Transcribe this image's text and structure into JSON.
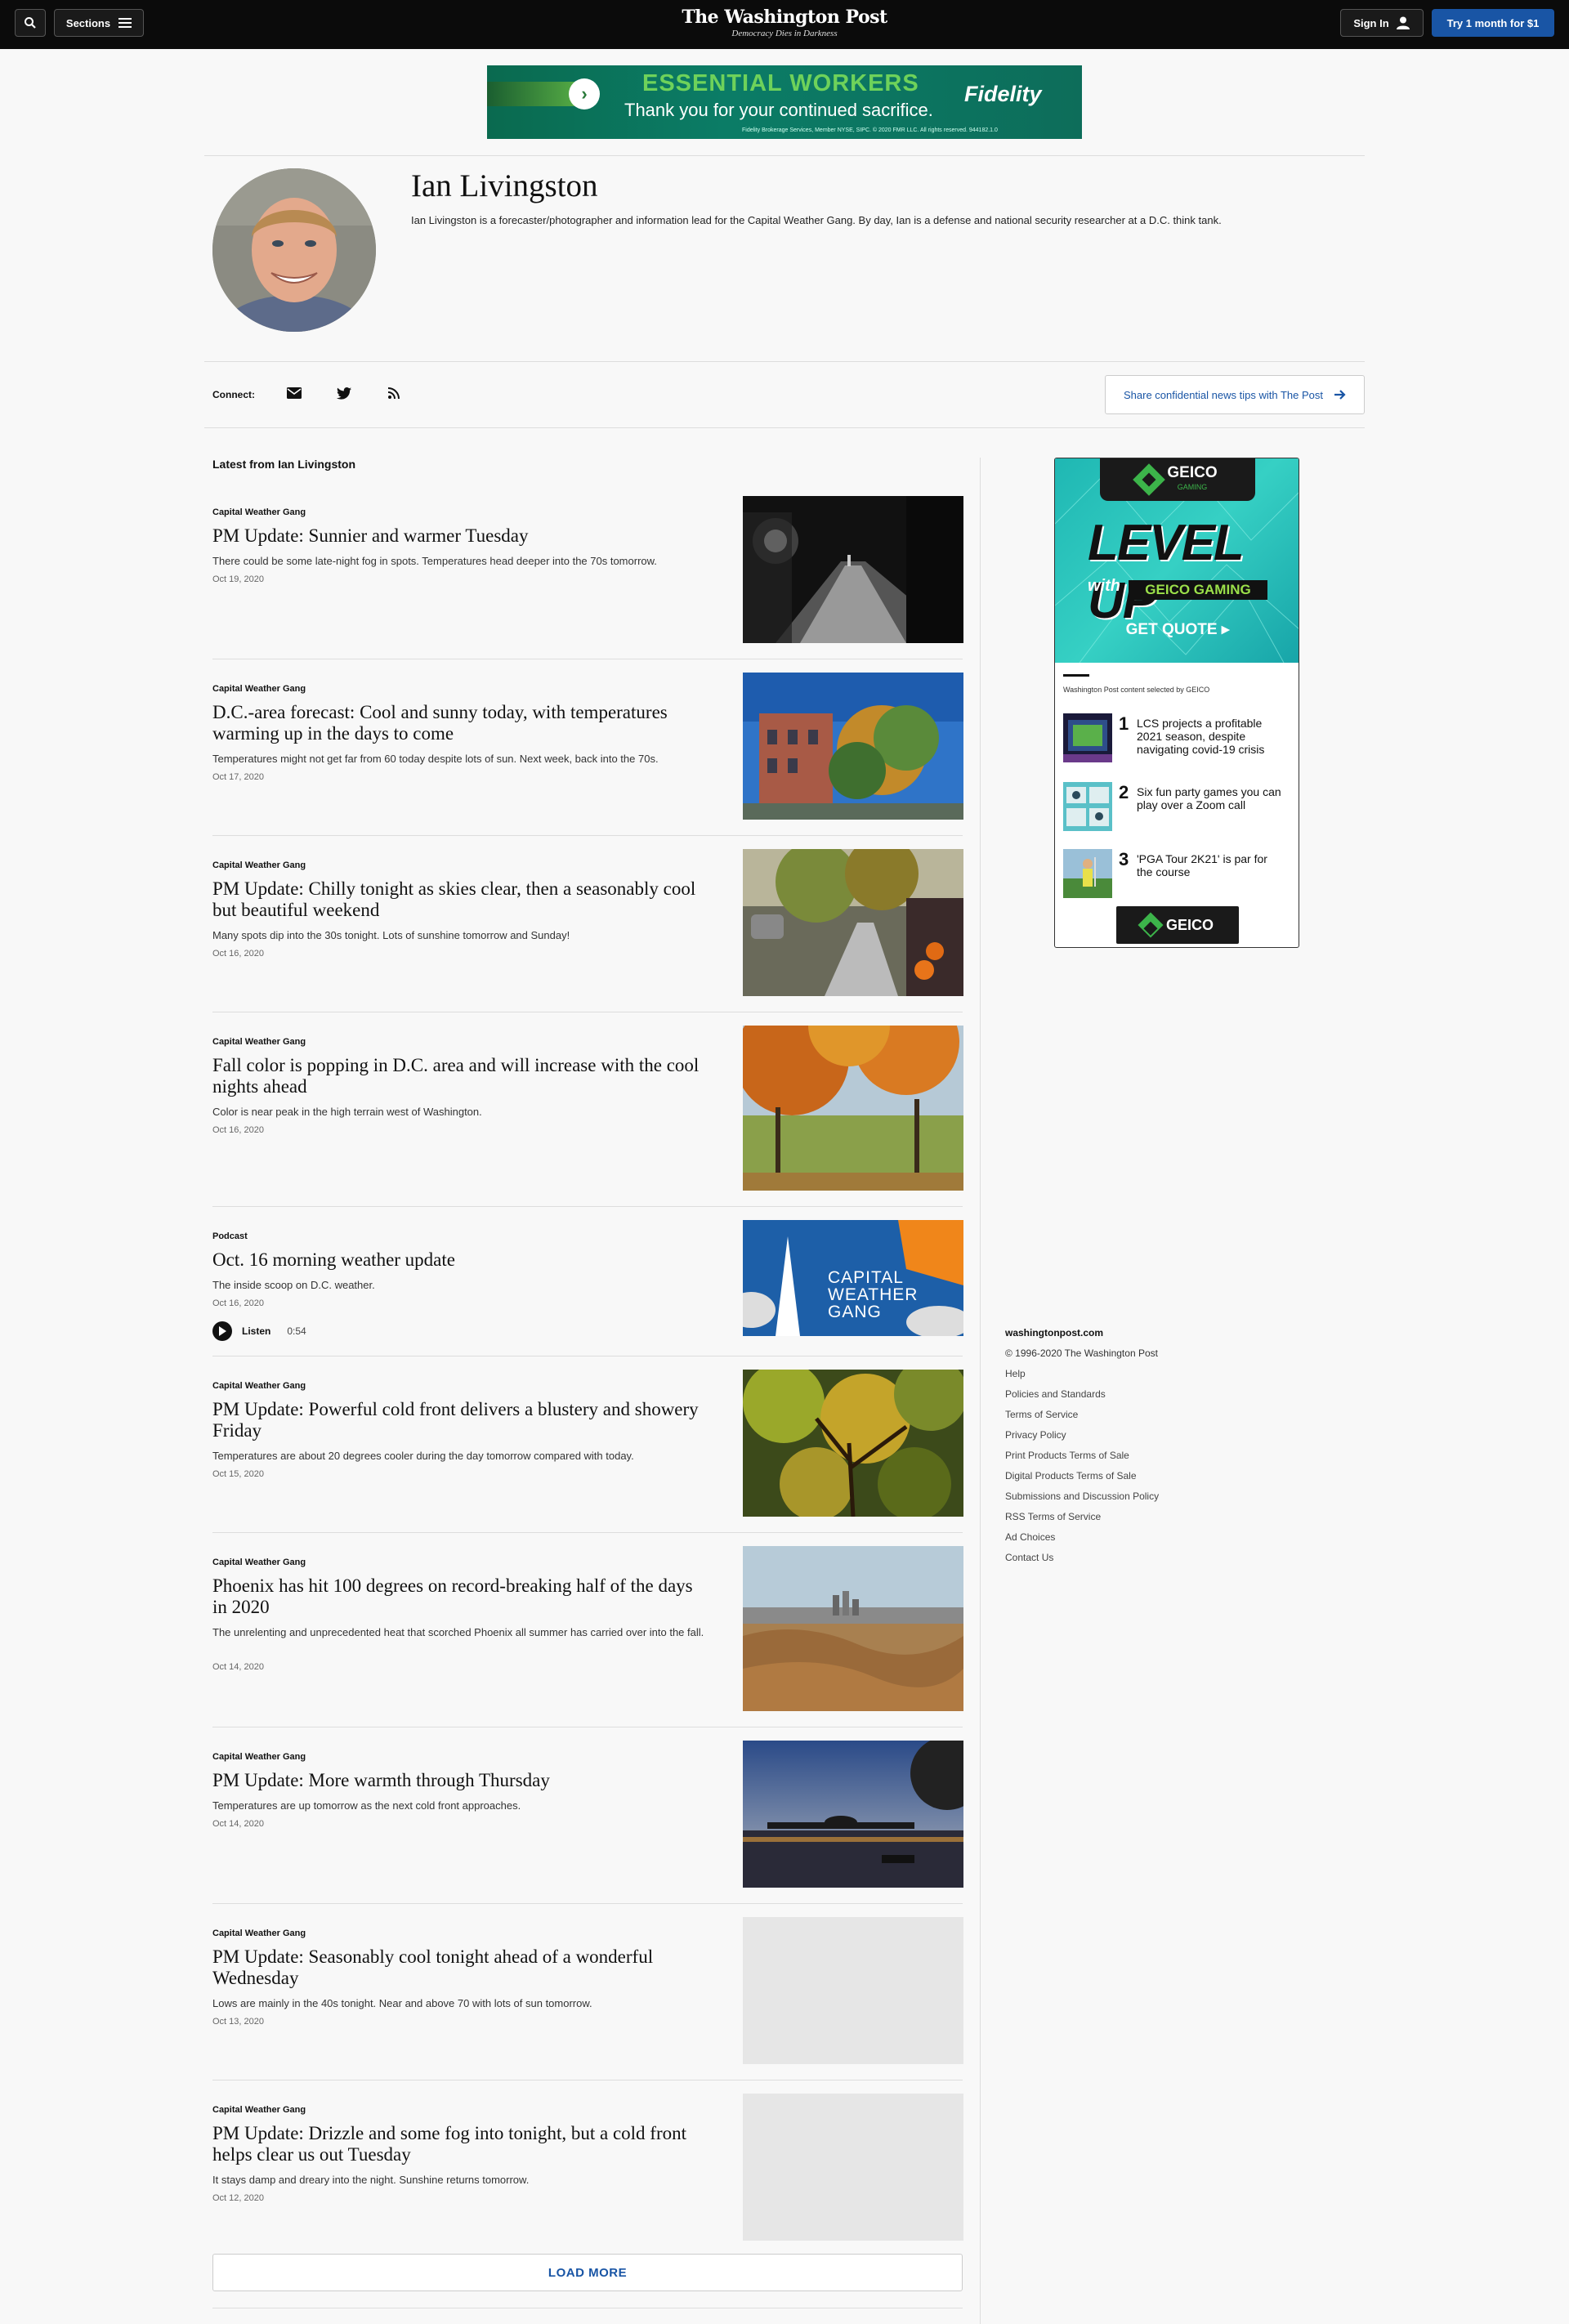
{
  "header": {
    "sections_label": "Sections",
    "logo_title": "The Washington Post",
    "logo_tagline": "Democracy Dies in Darkness",
    "signin_label": "Sign In",
    "subscribe_label": "Try 1 month for $1"
  },
  "top_ad": {
    "headline": "ESSENTIAL WORKERS",
    "subline": "Thank you for your continued sacrifice.",
    "brand": "Fidelity",
    "fine_print": "Fidelity Brokerage Services, Member NYSE, SIPC. © 2020 FMR LLC. All rights reserved. 944182.1.0"
  },
  "profile": {
    "name": "Ian Livingston",
    "bio": "Ian Livingston is a forecaster/photographer and information lead for the Capital Weather Gang. By day, Ian is a defense and national security researcher at a D.C. think tank.",
    "connect_label": "Connect:",
    "icons": [
      "email-icon",
      "twitter-icon",
      "rss-icon"
    ],
    "tips_label": "Share confidential news tips with The Post"
  },
  "latest_heading": "Latest from Ian Livingston",
  "articles": [
    {
      "kicker": "Capital Weather Gang",
      "headline": "PM Update: Sunnier and warmer Tuesday",
      "blurb": "There could be some late-night fog in spots. Temperatures head deeper into the 70s tomorrow.",
      "date": "Oct 19, 2020"
    },
    {
      "kicker": "Capital Weather Gang",
      "headline": "D.C.-area forecast: Cool and sunny today, with temperatures warming up in the days to come",
      "blurb": "Temperatures might not get far from 60 today despite lots of sun. Next week, back into the 70s.",
      "date": "Oct 17, 2020"
    },
    {
      "kicker": "Capital Weather Gang",
      "headline": "PM Update: Chilly tonight as skies clear, then a seasonably cool but beautiful weekend",
      "blurb": "Many spots dip into the 30s tonight. Lots of sunshine tomorrow and Sunday!",
      "date": "Oct 16, 2020"
    },
    {
      "kicker": "Capital Weather Gang",
      "headline": "Fall color is popping in D.C. area and will increase with the cool nights ahead",
      "blurb": "Color is near peak in the high terrain west of Washington.",
      "date": "Oct 16, 2020"
    },
    {
      "kicker": "Podcast",
      "headline": "Oct. 16 morning weather update",
      "blurb": "The inside scoop on D.C. weather.",
      "date": "Oct 16, 2020",
      "listen_label": "Listen",
      "duration": "0:54",
      "thumb_text": "CAPITAL WEATHER GANG"
    },
    {
      "kicker": "Capital Weather Gang",
      "headline": "PM Update: Powerful cold front delivers a blustery and showery Friday",
      "blurb": "Temperatures are about 20 degrees cooler during the day tomorrow compared with today.",
      "date": "Oct 15, 2020"
    },
    {
      "kicker": "Capital Weather Gang",
      "headline": "Phoenix has hit 100 degrees on record-breaking half of the days in 2020",
      "blurb": "The unrelenting and unprecedented heat that scorched Phoenix all summer has carried over into the fall.",
      "date": "Oct 14, 2020"
    },
    {
      "kicker": "Capital Weather Gang",
      "headline": "PM Update: More warmth through Thursday",
      "blurb": "Temperatures are up tomorrow as the next cold front approaches.",
      "date": "Oct 14, 2020"
    },
    {
      "kicker": "Capital Weather Gang",
      "headline": "PM Update: Seasonably cool tonight ahead of a wonderful Wednesday",
      "blurb": "Lows are mainly in the 40s tonight. Near and above 70 with lots of sun tomorrow.",
      "date": "Oct 13, 2020"
    },
    {
      "kicker": "Capital Weather Gang",
      "headline": "PM Update: Drizzle and some fog into tonight, but a cold front helps clear us out Tuesday",
      "blurb": "It stays damp and dreary into the night. Sunshine returns tomorrow.",
      "date": "Oct 12, 2020"
    }
  ],
  "load_more_label": "LOAD MORE",
  "rail_ad": {
    "brand": "GEICO",
    "brand_sub": "GAMING",
    "headline": "LEVEL UP",
    "with": "with",
    "gaming": "GEICO GAMING",
    "cta": "GET QUOTE ▸",
    "selected_by": "Washington Post content selected by GEICO",
    "items": [
      {
        "num": "1",
        "title": "LCS projects a profitable 2021 season, despite navigating covid-19 crisis"
      },
      {
        "num": "2",
        "title": "Six fun party games you can play over a Zoom call"
      },
      {
        "num": "3",
        "title": "'PGA Tour 2K21' is par for the course"
      }
    ]
  },
  "footer": {
    "site": "washingtonpost.com",
    "copyright": "© 1996-2020 The Washington Post",
    "links": [
      "Help",
      "Policies and Standards",
      "Terms of Service",
      "Privacy Policy",
      "Print Products Terms of Sale",
      "Digital Products Terms of Sale",
      "Submissions and Discussion Policy",
      "RSS Terms of Service",
      "Ad Choices",
      "Contact Us"
    ]
  }
}
